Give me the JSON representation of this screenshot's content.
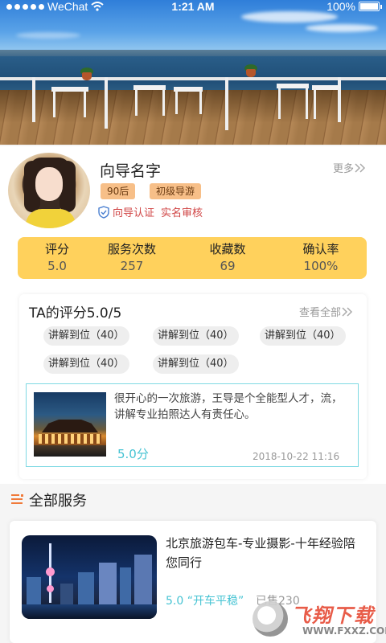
{
  "status_bar": {
    "carrier": "WeChat",
    "time": "1:21 AM",
    "battery": "100%"
  },
  "guide": {
    "name": "向导名字",
    "more_label": "更多",
    "tags": [
      "90后",
      "初级导游"
    ],
    "certifications": [
      "向导认证",
      "实名审核"
    ]
  },
  "stats": [
    {
      "label": "评分",
      "value": "5.0"
    },
    {
      "label": "服务次数",
      "value": "257"
    },
    {
      "label": "收藏数",
      "value": "69"
    },
    {
      "label": "确认率",
      "value": "100%"
    }
  ],
  "reviews": {
    "title": "TA的评分5.0/5",
    "see_all_label": "查看全部",
    "chips": [
      "讲解到位（40）",
      "讲解到位（40）",
      "讲解到位（40）",
      "讲解到位（40）",
      "讲解到位（40）"
    ],
    "comment": {
      "text": "很开心的一次旅游，王导是个全能型人才，流，讲解专业拍照达人有责任心。",
      "score": "5.0分",
      "date": "2018-10-22 11:16"
    }
  },
  "services": {
    "section_title": "全部服务",
    "items": [
      {
        "title": "北京旅游包车-专业摄影-十年经验陪您同行",
        "rating_and_tag": "5.0 “开车平稳”",
        "sold": "已售230"
      }
    ]
  },
  "watermark": {
    "text": "飞翔下载",
    "url": "WWW.FXXZ.COM"
  },
  "colors": {
    "stats_bg": "#ffd15c",
    "tag_bg": "#f7bf88",
    "accent_cyan": "#45c3d3",
    "cert_red": "#d04545",
    "section_icon": "#f07a3a"
  }
}
